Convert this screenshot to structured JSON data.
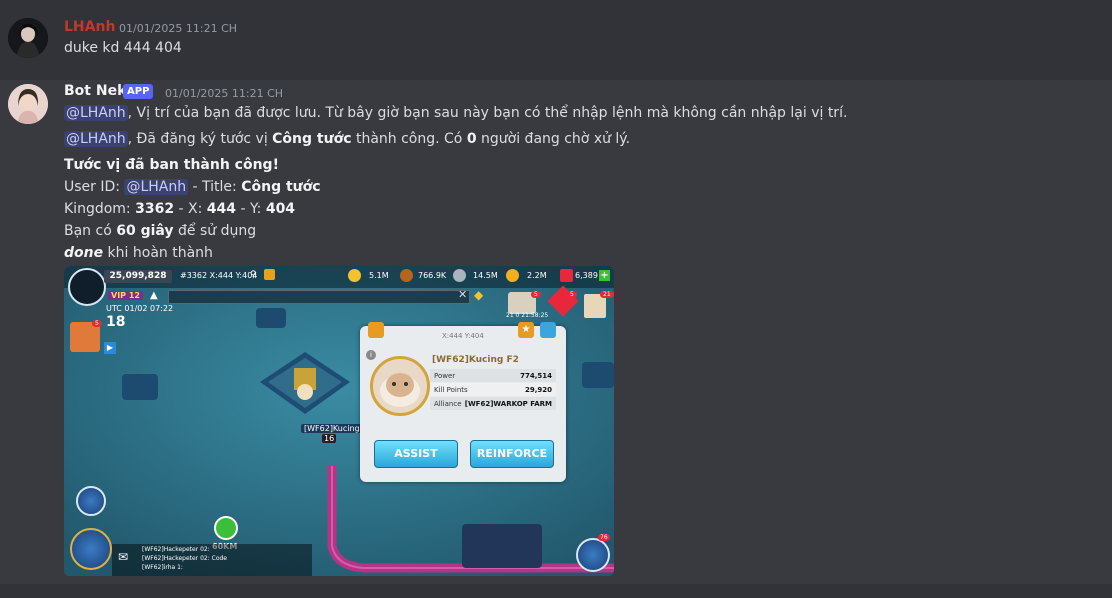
{
  "messages": [
    {
      "author": "LHAnh",
      "timestamp": "01/01/2025 11:21 CH",
      "text": "duke kd 444 404",
      "name_color": "#c0392b"
    },
    {
      "author": "Bot Nek",
      "badge": "APP",
      "timestamp": "01/01/2025 11:21 CH",
      "lines": {
        "l1_mention": "@LHAnh",
        "l1_rest": ", Vị trí của bạn đã được lưu. Từ bây giờ bạn sau này bạn có thể nhập lệnh mà không cần nhập lại vị trí.",
        "l2_mention": "@LHAnh",
        "l2_a": ", Đã đăng ký tước vị ",
        "l2_b": "Công tước",
        "l2_c": " thành công. Có ",
        "l2_d": "0",
        "l2_e": " người đang chờ xử lý.",
        "l3": "Tước vị đã ban thành công!",
        "l4_a": "User ID: ",
        "l4_mention": "@LHAnh",
        "l4_b": " - Title: ",
        "l4_c": "Công tước",
        "l5_a": "Kingdom: ",
        "l5_b": "3362",
        "l5_c": " - X: ",
        "l5_d": "444",
        "l5_e": " - Y: ",
        "l5_f": "404",
        "l6_a": "Bạn có ",
        "l6_b": "60 giây",
        "l6_c": " để sử dụng",
        "l7_a": "done",
        "l7_b": " khi hoàn thành"
      }
    }
  ],
  "game": {
    "power": "25,099,828",
    "coords": "#3362 X:444 Y:404",
    "resources": [
      {
        "name": "food",
        "value": "5.1M",
        "color": "#f2c230"
      },
      {
        "name": "wood",
        "value": "766.9K",
        "color": "#b5651d"
      },
      {
        "name": "stone",
        "value": "14.5M",
        "color": "#a9b4bf"
      },
      {
        "name": "gold",
        "value": "2.2M",
        "color": "#f2b01e"
      },
      {
        "name": "gems",
        "value": "6,389",
        "color": "#e8283a"
      }
    ],
    "vip": "VIP 12",
    "time": "UTC 01/02 07:22",
    "timer": "21 0 21:58:25",
    "age": "18",
    "badges": {
      "b1": "5",
      "b2": "5",
      "b3": "21",
      "b4": "5",
      "menu": "76"
    },
    "popup": {
      "coord": "X:444 Y:404",
      "name": "[WF62]Kucing F2",
      "rows": [
        {
          "label": "Power",
          "value": "774,514"
        },
        {
          "label": "Kill Points",
          "value": "29,920"
        },
        {
          "label": "Alliance",
          "value": "[WF62]WARKOP FARM"
        }
      ],
      "assist": "ASSIST",
      "reinforce": "REINFORCE"
    },
    "city_label": "[WF62]Kucing F2",
    "city_level": "16",
    "distance": "60KM",
    "chat": [
      {
        "a": "[WF62]Hackepeter",
        "b": " 02:",
        "c": " "
      },
      {
        "a": "[WF62]Hackepeter",
        "b": " 02:",
        "c": " Code"
      },
      {
        "a": "[WF62]",
        "b": "irha 1:",
        "c": " "
      }
    ]
  }
}
